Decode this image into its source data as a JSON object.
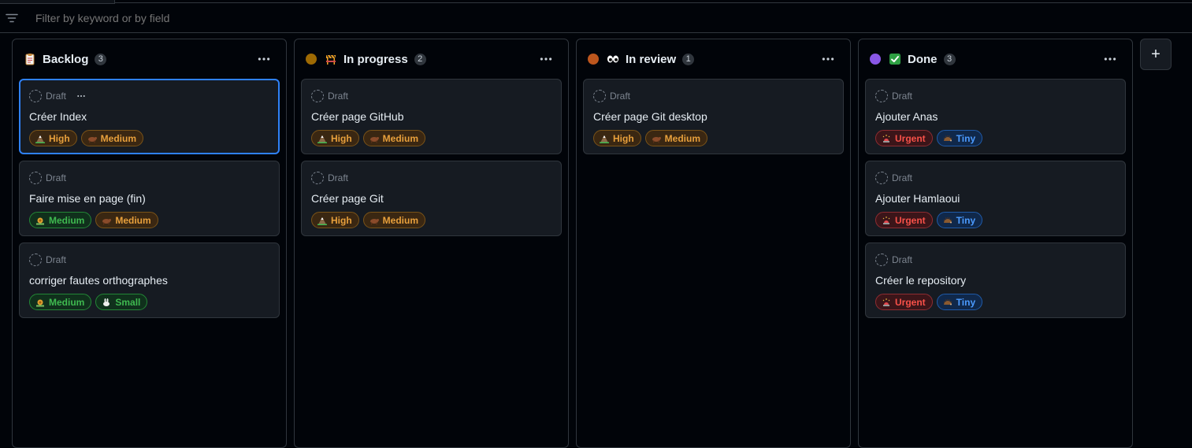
{
  "filter": {
    "placeholder": "Filter by keyword or by field"
  },
  "add_column_label": "+",
  "columns": [
    {
      "title": "Backlog",
      "count": "3",
      "icon": "clipboard-icon",
      "dot_color": "",
      "cards": [
        {
          "status": "Draft",
          "title": "Créer Index",
          "labels": [
            {
              "text": "High",
              "icon": "mountain-icon",
              "tone": "orange"
            },
            {
              "text": "Medium",
              "icon": "ox-icon",
              "tone": "orange"
            }
          ]
        },
        {
          "status": "Draft",
          "title": "Faire mise en page (fin)",
          "labels": [
            {
              "text": "Medium",
              "icon": "snail-icon",
              "tone": "green"
            },
            {
              "text": "Medium",
              "icon": "ox-icon",
              "tone": "orange"
            }
          ]
        },
        {
          "status": "Draft",
          "title": "corriger fautes orthographes",
          "labels": [
            {
              "text": "Medium",
              "icon": "snail-icon",
              "tone": "green"
            },
            {
              "text": "Small",
              "icon": "rabbit-icon",
              "tone": "green"
            }
          ]
        }
      ]
    },
    {
      "title": "In progress",
      "count": "2",
      "icon": "construction-icon",
      "dot_color": "#9e6a03",
      "cards": [
        {
          "status": "Draft",
          "title": "Créer page GitHub",
          "labels": [
            {
              "text": "High",
              "icon": "mountain-icon",
              "tone": "orange"
            },
            {
              "text": "Medium",
              "icon": "ox-icon",
              "tone": "orange"
            }
          ]
        },
        {
          "status": "Draft",
          "title": "Créer page Git",
          "labels": [
            {
              "text": "High",
              "icon": "mountain-icon",
              "tone": "orange"
            },
            {
              "text": "Medium",
              "icon": "ox-icon",
              "tone": "orange"
            }
          ]
        }
      ]
    },
    {
      "title": "In review",
      "count": "1",
      "icon": "eyes-icon",
      "dot_color": "#bd561d",
      "cards": [
        {
          "status": "Draft",
          "title": "Créer page Git desktop",
          "labels": [
            {
              "text": "High",
              "icon": "mountain-icon",
              "tone": "orange"
            },
            {
              "text": "Medium",
              "icon": "ox-icon",
              "tone": "orange"
            }
          ]
        }
      ]
    },
    {
      "title": "Done",
      "count": "3",
      "icon": "check-box-icon",
      "dot_color": "#8957e5",
      "cards": [
        {
          "status": "Draft",
          "title": "Ajouter Anas",
          "labels": [
            {
              "text": "Urgent",
              "icon": "siren-icon",
              "tone": "red"
            },
            {
              "text": "Tiny",
              "icon": "hedgehog-icon",
              "tone": "blue"
            }
          ]
        },
        {
          "status": "Draft",
          "title": "Ajouter Hamlaoui",
          "labels": [
            {
              "text": "Urgent",
              "icon": "siren-icon",
              "tone": "red"
            },
            {
              "text": "Tiny",
              "icon": "hedgehog-icon",
              "tone": "blue"
            }
          ]
        },
        {
          "status": "Draft",
          "title": "Créer le repository",
          "labels": [
            {
              "text": "Urgent",
              "icon": "siren-icon",
              "tone": "red"
            },
            {
              "text": "Tiny",
              "icon": "hedgehog-icon",
              "tone": "blue"
            }
          ]
        }
      ]
    }
  ]
}
